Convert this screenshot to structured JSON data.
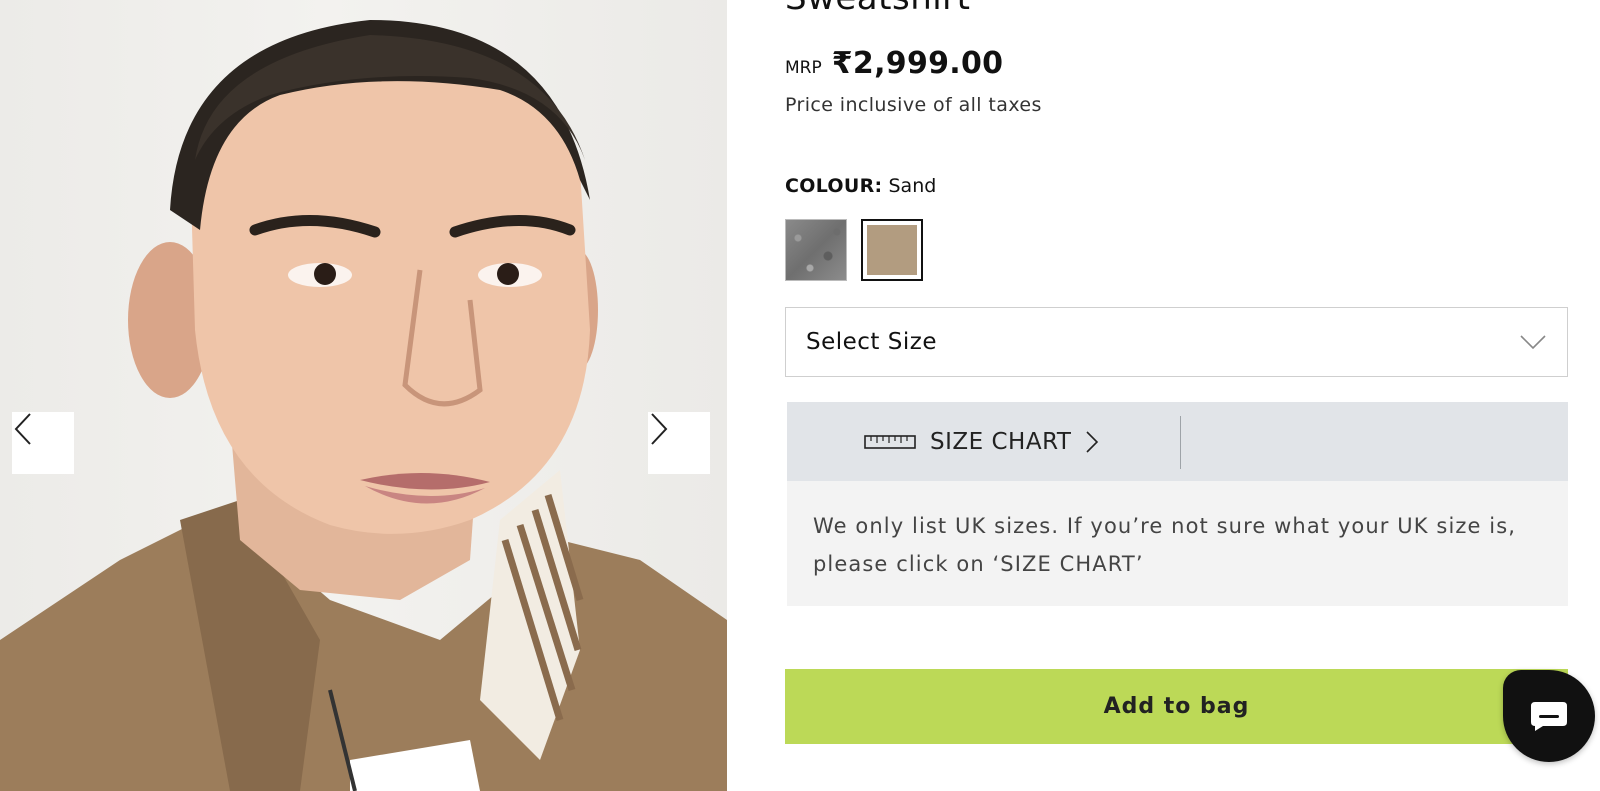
{
  "product": {
    "title": "Sweatshirt",
    "price_label": "MRP",
    "price": "₹2,999.00",
    "tax_note": "Price inclusive of all taxes"
  },
  "gallery": {
    "prev_icon": "chevron-left-icon",
    "next_icon": "chevron-right-icon"
  },
  "colour": {
    "label": "COLOUR:",
    "selected": "Sand",
    "swatches": [
      {
        "name": "Grey Melange",
        "color": "#7d7d7d"
      },
      {
        "name": "Sand",
        "color": "#b29c80"
      }
    ]
  },
  "size": {
    "select_placeholder": "Select Size",
    "chart_label": "SIZE CHART",
    "note": "We only list UK sizes. If you’re not sure what your UK size is, please click on ‘SIZE CHART’"
  },
  "actions": {
    "add_to_bag": "Add to bag"
  },
  "colors": {
    "accent": "#bcd957",
    "size_chart_bg": "#e1e4e8",
    "note_bg": "#f3f3f3"
  }
}
